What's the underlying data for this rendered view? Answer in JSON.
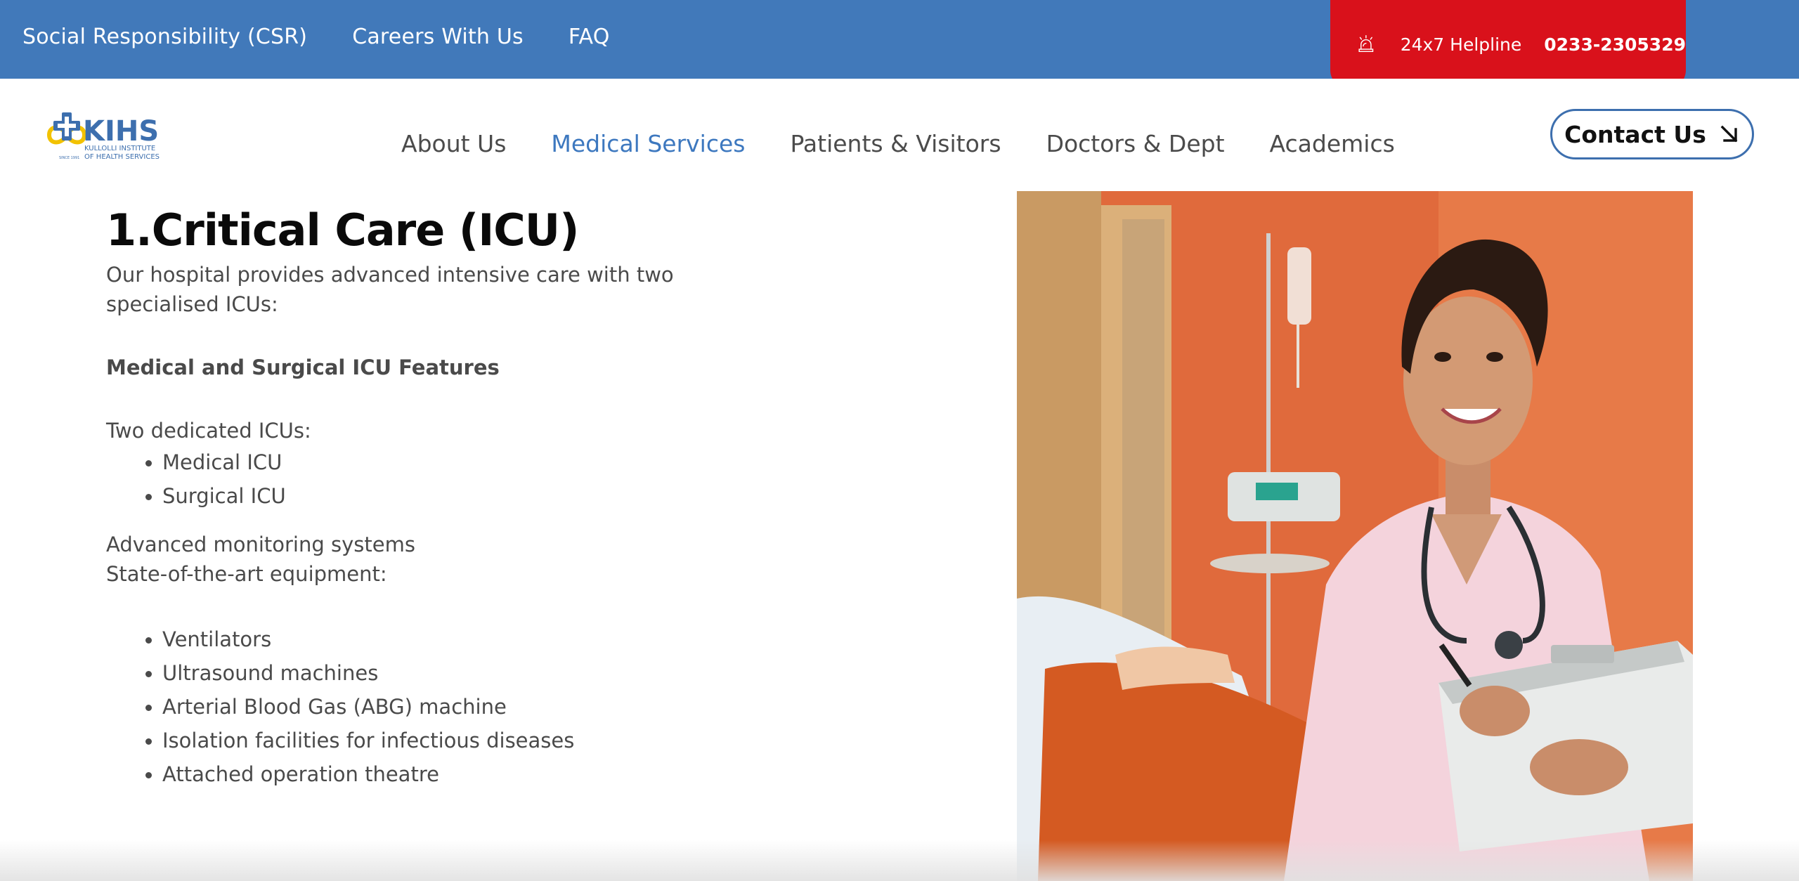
{
  "topbar": {
    "links": [
      "Social Responsibility (CSR)",
      "Careers With Us",
      "FAQ"
    ],
    "helpline_label": "24x7 Helpline",
    "helpline_number": "0233-2305329",
    "helpline_icon": "alarm-bell-icon",
    "bar_color": "#4179ba",
    "helpline_color": "#d9111b"
  },
  "logo": {
    "text": "KIHS",
    "subtitle_line1": "KULLOLLI INSTITUTE",
    "subtitle_line2": "OF HEALTH SERVICES"
  },
  "nav": {
    "items": [
      "About Us",
      "Medical Services",
      "Patients & Visitors",
      "Doctors & Dept",
      "Academics"
    ],
    "active": "Medical Services",
    "contact_label": "Contact Us",
    "contact_icon": "arrow-down-right-icon",
    "accent_color": "#3d78bf"
  },
  "content": {
    "title": "1.Critical Care (ICU)",
    "intro": "Our hospital provides advanced intensive care with two specialised ICUs:",
    "features_heading": "Medical and Surgical ICU Features",
    "icus_label": "Two dedicated ICUs:",
    "icus": [
      "Medical ICU",
      "Surgical ICU"
    ],
    "monitoring": "Advanced monitoring systems",
    "equipment_label": "State-of-the-art equipment:",
    "equipment": [
      "Ventilators",
      "Ultrasound machines",
      "Arterial Blood Gas (ABG) machine",
      "Isolation facilities for infectious diseases",
      "Attached operation theatre"
    ]
  }
}
